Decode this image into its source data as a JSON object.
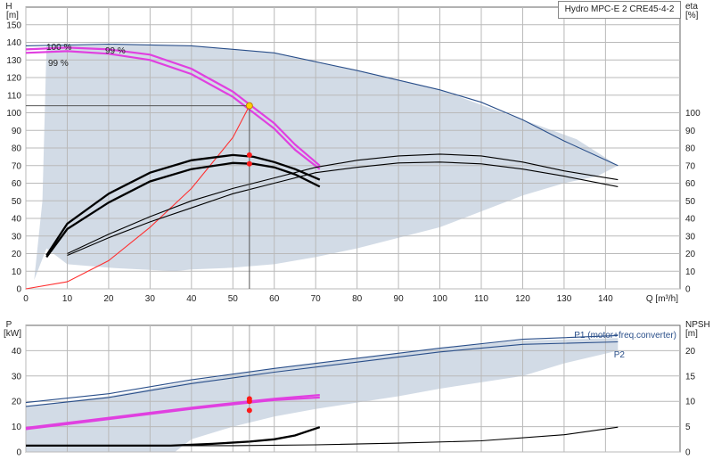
{
  "chart_data": [
    {
      "type": "line",
      "title": "Hydro MPC-E 2 CRE45-4-2",
      "left_axis": {
        "label": "H",
        "unit": "[m]",
        "ticks": [
          0,
          10,
          20,
          30,
          40,
          50,
          60,
          70,
          80,
          90,
          100,
          110,
          120,
          130,
          140,
          150
        ],
        "ylim": [
          0,
          160
        ]
      },
      "right_axis": {
        "label": "eta",
        "unit": "[%]",
        "ticks": [
          0,
          10,
          20,
          30,
          40,
          50,
          60,
          70,
          80,
          90,
          100
        ],
        "ylim": [
          0,
          160
        ]
      },
      "xlabel": "Q [m³/h]",
      "xticks": [
        0,
        10,
        20,
        30,
        40,
        50,
        60,
        70,
        80,
        90,
        100,
        110,
        120,
        130,
        140
      ],
      "xlim": [
        0,
        158
      ],
      "grid": true,
      "labels": [
        "100 %",
        "99 %",
        "99 %"
      ],
      "operating_region": [
        [
          2,
          5
        ],
        [
          4,
          50
        ],
        [
          5,
          138
        ],
        [
          20,
          139
        ],
        [
          40,
          138
        ],
        [
          60,
          134
        ],
        [
          80,
          124
        ],
        [
          100,
          113
        ],
        [
          120,
          96
        ],
        [
          133,
          85
        ],
        [
          143,
          70
        ],
        [
          138,
          64
        ],
        [
          130,
          60
        ],
        [
          120,
          53
        ],
        [
          110,
          44
        ],
        [
          100,
          35
        ],
        [
          90,
          29
        ],
        [
          80,
          23
        ],
        [
          70,
          18
        ],
        [
          60,
          14
        ],
        [
          50,
          12
        ],
        [
          40,
          11
        ],
        [
          36,
          10
        ],
        [
          20,
          12
        ],
        [
          10,
          14
        ],
        [
          5,
          23
        ]
      ],
      "series": [
        {
          "role": "head_max",
          "color": "#2a4f8a",
          "points": [
            [
              0,
              138
            ],
            [
              20,
              139
            ],
            [
              40,
              138
            ],
            [
              60,
              134
            ],
            [
              80,
              124
            ],
            [
              100,
              113
            ],
            [
              110,
              106
            ],
            [
              120,
              96
            ],
            [
              130,
              84
            ],
            [
              143,
              70
            ]
          ]
        },
        {
          "role": "head_100",
          "color": "#e040e0",
          "points": [
            [
              0,
              136
            ],
            [
              10,
              137
            ],
            [
              20,
              136
            ],
            [
              30,
              133
            ],
            [
              40,
              125
            ],
            [
              50,
              112
            ],
            [
              55,
              103
            ],
            [
              60,
              94
            ],
            [
              65,
              82
            ],
            [
              71,
              70
            ]
          ]
        },
        {
          "role": "head_99",
          "color": "#e040e0",
          "points": [
            [
              0,
              134
            ],
            [
              10,
              135
            ],
            [
              20,
              133.5
            ],
            [
              30,
              130
            ],
            [
              40,
              122
            ],
            [
              50,
              109
            ],
            [
              55,
              100
            ],
            [
              60,
              91
            ],
            [
              65,
              79
            ],
            [
              71,
              68
            ]
          ]
        },
        {
          "role": "system_curve",
          "color": "#ff3030",
          "points": [
            [
              0,
              0
            ],
            [
              10,
              4
            ],
            [
              20,
              16
            ],
            [
              30,
              35
            ],
            [
              40,
              57
            ],
            [
              50,
              86
            ],
            [
              54,
              104
            ]
          ]
        },
        {
          "role": "eta_pump",
          "color": "#000000",
          "points": [
            [
              5,
              19
            ],
            [
              10,
              37
            ],
            [
              20,
              54
            ],
            [
              30,
              66
            ],
            [
              40,
              73
            ],
            [
              50,
              76
            ],
            [
              55,
              75
            ],
            [
              60,
              72
            ],
            [
              65,
              68
            ],
            [
              71,
              62
            ]
          ]
        },
        {
          "role": "eta_total",
          "color": "#000000",
          "points": [
            [
              5,
              18
            ],
            [
              10,
              34
            ],
            [
              20,
              49
            ],
            [
              30,
              61
            ],
            [
              40,
              68
            ],
            [
              50,
              71.5
            ],
            [
              55,
              71
            ],
            [
              60,
              69
            ],
            [
              65,
              65
            ],
            [
              71,
              58
            ]
          ]
        },
        {
          "role": "eta_max",
          "color": "#000000",
          "points": [
            [
              10,
              20
            ],
            [
              20,
              31
            ],
            [
              30,
              41
            ],
            [
              40,
              50
            ],
            [
              50,
              57
            ],
            [
              60,
              63
            ],
            [
              70,
              69
            ],
            [
              80,
              73
            ],
            [
              90,
              75.5
            ],
            [
              100,
              76.5
            ],
            [
              110,
              75.5
            ],
            [
              120,
              72
            ],
            [
              130,
              67
            ],
            [
              143,
              62
            ]
          ]
        },
        {
          "role": "eta_max_total",
          "color": "#000000",
          "points": [
            [
              10,
              19
            ],
            [
              20,
              29
            ],
            [
              30,
              38
            ],
            [
              40,
              46
            ],
            [
              50,
              54
            ],
            [
              60,
              60
            ],
            [
              70,
              66
            ],
            [
              80,
              69
            ],
            [
              90,
              71.5
            ],
            [
              100,
              72
            ],
            [
              110,
              71
            ],
            [
              120,
              68
            ],
            [
              130,
              64
            ],
            [
              143,
              58
            ]
          ]
        }
      ],
      "duty_point": {
        "q": 54,
        "h": 104,
        "eta_pump": 76,
        "eta_total": 71
      }
    },
    {
      "type": "line",
      "left_axis": {
        "label": "P",
        "unit": "[kW]",
        "ticks": [
          0,
          10,
          20,
          30,
          40
        ],
        "ylim": [
          0,
          50
        ]
      },
      "right_axis": {
        "label": "NPSH",
        "unit": "[m]",
        "ticks": [
          0,
          5,
          10,
          15,
          20
        ],
        "ylim": [
          0,
          25
        ]
      },
      "xticks": [
        0,
        10,
        20,
        30,
        40,
        50,
        60,
        70,
        80,
        90,
        100,
        110,
        120,
        130,
        140
      ],
      "xlim": [
        0,
        158
      ],
      "grid": true,
      "labels": [
        "P1 (motor+freq.converter)",
        "P2"
      ],
      "band_region": [
        [
          0,
          18
        ],
        [
          20,
          22
        ],
        [
          40,
          28
        ],
        [
          60,
          33
        ],
        [
          80,
          37
        ],
        [
          100,
          41
        ],
        [
          120,
          44
        ],
        [
          143,
          45
        ],
        [
          143,
          40
        ],
        [
          130,
          35
        ],
        [
          120,
          30
        ],
        [
          100,
          25
        ],
        [
          90,
          22
        ],
        [
          80,
          19.5
        ],
        [
          70,
          17
        ],
        [
          60,
          14
        ],
        [
          50,
          10
        ],
        [
          40,
          5
        ],
        [
          36,
          0
        ],
        [
          0,
          0
        ]
      ],
      "series": [
        {
          "role": "p1_max",
          "color": "#2a4f8a",
          "points": [
            [
              0,
              19.5
            ],
            [
              20,
              23
            ],
            [
              40,
              28.5
            ],
            [
              60,
              33
            ],
            [
              80,
              37
            ],
            [
              100,
              41
            ],
            [
              120,
              44.5
            ],
            [
              143,
              46
            ]
          ]
        },
        {
          "role": "p2_max",
          "color": "#2a4f8a",
          "points": [
            [
              0,
              18
            ],
            [
              20,
              21.5
            ],
            [
              40,
              27
            ],
            [
              60,
              31.5
            ],
            [
              80,
              35.5
            ],
            [
              100,
              39.5
            ],
            [
              120,
              42.5
            ],
            [
              143,
              43.5
            ]
          ]
        },
        {
          "role": "p1_duty",
          "color": "#e040e0",
          "points": [
            [
              0,
              9.5
            ],
            [
              20,
              13.5
            ],
            [
              40,
              17.5
            ],
            [
              54,
              20
            ],
            [
              60,
              21
            ],
            [
              71,
              22.5
            ]
          ]
        },
        {
          "role": "p2_duty",
          "color": "#e040e0",
          "points": [
            [
              0,
              9
            ],
            [
              20,
              13
            ],
            [
              40,
              17
            ],
            [
              54,
              19.5
            ],
            [
              60,
              20.5
            ],
            [
              71,
              21.5
            ]
          ]
        },
        {
          "role": "npsh_duty",
          "color": "#000000",
          "points": [
            [
              0,
              2.5
            ],
            [
              20,
              2.5
            ],
            [
              35,
              2.5
            ],
            [
              45,
              3.2
            ],
            [
              54,
              4.1
            ],
            [
              60,
              5
            ],
            [
              65,
              6.5
            ],
            [
              71,
              9.8
            ]
          ]
        },
        {
          "role": "npsh_max",
          "color": "#000000",
          "points": [
            [
              0,
              2.5
            ],
            [
              30,
              2.5
            ],
            [
              50,
              2.5
            ],
            [
              70,
              2.8
            ],
            [
              90,
              3.5
            ],
            [
              110,
              4.4
            ],
            [
              130,
              6.8
            ],
            [
              143,
              9.8
            ]
          ]
        }
      ],
      "duty_point": {
        "q": 54,
        "p1": 21,
        "p2": 20,
        "npsh": 4.1
      }
    }
  ]
}
